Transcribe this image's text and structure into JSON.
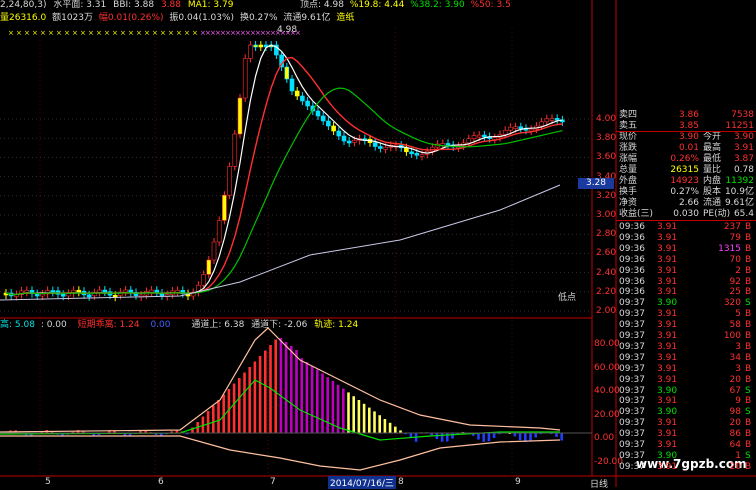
{
  "colors": {
    "up": "#ff3030",
    "down": "#00e0ff",
    "flat": "#ffffff",
    "ma_short": "#ffffff",
    "ma_mid": "#ff3030",
    "ma_long": "#00c000",
    "ma_year": "#c0c0ff"
  },
  "header": {
    "params": "2,24,80,3)",
    "level_label": "水平面: 3.31",
    "bbi": "BBI: 3.88",
    "bbi_val2": "3.88",
    "ma1": "MA1: 3.79",
    "top_point": "顶点: 4.98",
    "pct19": "%19.8: 4.44",
    "pct38": "%38.2: 3.90",
    "pct50": "%50: 3.5"
  },
  "header2": {
    "vol": "量26316.0",
    "amount": "额1023万",
    "change": "幅0.01(0.26%)",
    "turnover": "振0.04(1.03%)",
    "hs": "换0.27%",
    "float_cap": "流通9.61亿",
    "tag": "造纸"
  },
  "main_chart": {
    "peak_label": "4.98",
    "low_label": "低点",
    "price_axis": [
      "4.00",
      "3.80",
      "3.60",
      "3.40",
      "3.20",
      "3.00",
      "2.80",
      "2.60",
      "2.40",
      "2.20",
      "2.00"
    ],
    "current_price_tag": "3.28"
  },
  "indicator": {
    "label1": "高: 5.08",
    "label2": ": 0.00",
    "label3": "短期乖离: 1.24",
    "label4": "0.00",
    "label5": "通道上: 6.38",
    "label6": "通道下: -2.06",
    "label7": "轨迹: 1.24",
    "axis": [
      "80.00",
      "60.00",
      "40.00",
      "20.00",
      "0.00",
      "-20.00"
    ]
  },
  "bottom_axis": {
    "labels": [
      "5",
      "6",
      "7",
      "2014/07/16/三",
      "8",
      "9"
    ],
    "period": "日线"
  },
  "watermark": "www.7gpzb.com",
  "quote": {
    "rows": [
      {
        "l1": "卖四",
        "v1": "3.86",
        "l2": "",
        "v2": "7538"
      },
      {
        "l1": "卖五",
        "v1": "3.85",
        "l2": "",
        "v2": "11251"
      },
      {
        "l1": "现价",
        "v1": "3.90",
        "l2": "今开",
        "v2": "3.90"
      },
      {
        "l1": "涨跌",
        "v1": "0.01",
        "l2": "最高",
        "v2": "3.91"
      },
      {
        "l1": "涨幅",
        "v1": "0.26%",
        "l2": "最低",
        "v2": "3.87"
      },
      {
        "l1": "总量",
        "v1": "26315",
        "l2": "量比",
        "v2": "0.78"
      },
      {
        "l1": "外盘",
        "v1": "14923",
        "l2": "内盘",
        "v2": "11392"
      },
      {
        "l1": "换手",
        "v1": "0.27%",
        "l2": "股本",
        "v2": "10.9亿"
      },
      {
        "l1": "净资",
        "v1": "2.66",
        "l2": "流通",
        "v2": "9.61亿"
      },
      {
        "l1": "收益(三)",
        "v1": "0.030",
        "l2": "PE(动)",
        "v2": "65.4"
      }
    ]
  },
  "trades": [
    {
      "t": "09:36",
      "p": "3.91",
      "v": "237",
      "s": "B"
    },
    {
      "t": "09:36",
      "p": "3.91",
      "v": "79",
      "s": "B"
    },
    {
      "t": "09:36",
      "p": "3.91",
      "v": "1315",
      "s": "B"
    },
    {
      "t": "09:36",
      "p": "3.91",
      "v": "70",
      "s": "B"
    },
    {
      "t": "09:36",
      "p": "3.91",
      "v": "2",
      "s": "B"
    },
    {
      "t": "09:36",
      "p": "3.91",
      "v": "92",
      "s": "B"
    },
    {
      "t": "09:36",
      "p": "3.91",
      "v": "25",
      "s": "B"
    },
    {
      "t": "09:37",
      "p": "3.90",
      "v": "320",
      "s": "S"
    },
    {
      "t": "09:37",
      "p": "3.91",
      "v": "5",
      "s": "B"
    },
    {
      "t": "09:37",
      "p": "3.91",
      "v": "58",
      "s": "B"
    },
    {
      "t": "09:37",
      "p": "3.91",
      "v": "100",
      "s": "B"
    },
    {
      "t": "09:37",
      "p": "3.91",
      "v": "3",
      "s": "B"
    },
    {
      "t": "09:37",
      "p": "3.91",
      "v": "34",
      "s": "B"
    },
    {
      "t": "09:37",
      "p": "3.91",
      "v": "3",
      "s": "B"
    },
    {
      "t": "09:37",
      "p": "3.91",
      "v": "20",
      "s": "B"
    },
    {
      "t": "09:37",
      "p": "3.90",
      "v": "67",
      "s": "S"
    },
    {
      "t": "09:37",
      "p": "3.91",
      "v": "9",
      "s": "B"
    },
    {
      "t": "09:37",
      "p": "3.90",
      "v": "98",
      "s": "S"
    },
    {
      "t": "09:37",
      "p": "3.91",
      "v": "20",
      "s": "B"
    },
    {
      "t": "09:37",
      "p": "3.91",
      "v": "86",
      "s": "B"
    },
    {
      "t": "09:37",
      "p": "3.91",
      "v": "64",
      "s": "B"
    },
    {
      "t": "09:37",
      "p": "3.90",
      "v": "1",
      "s": "S"
    },
    {
      "t": "09:37",
      "p": "3.91",
      "v": "20",
      "s": "B"
    }
  ]
}
